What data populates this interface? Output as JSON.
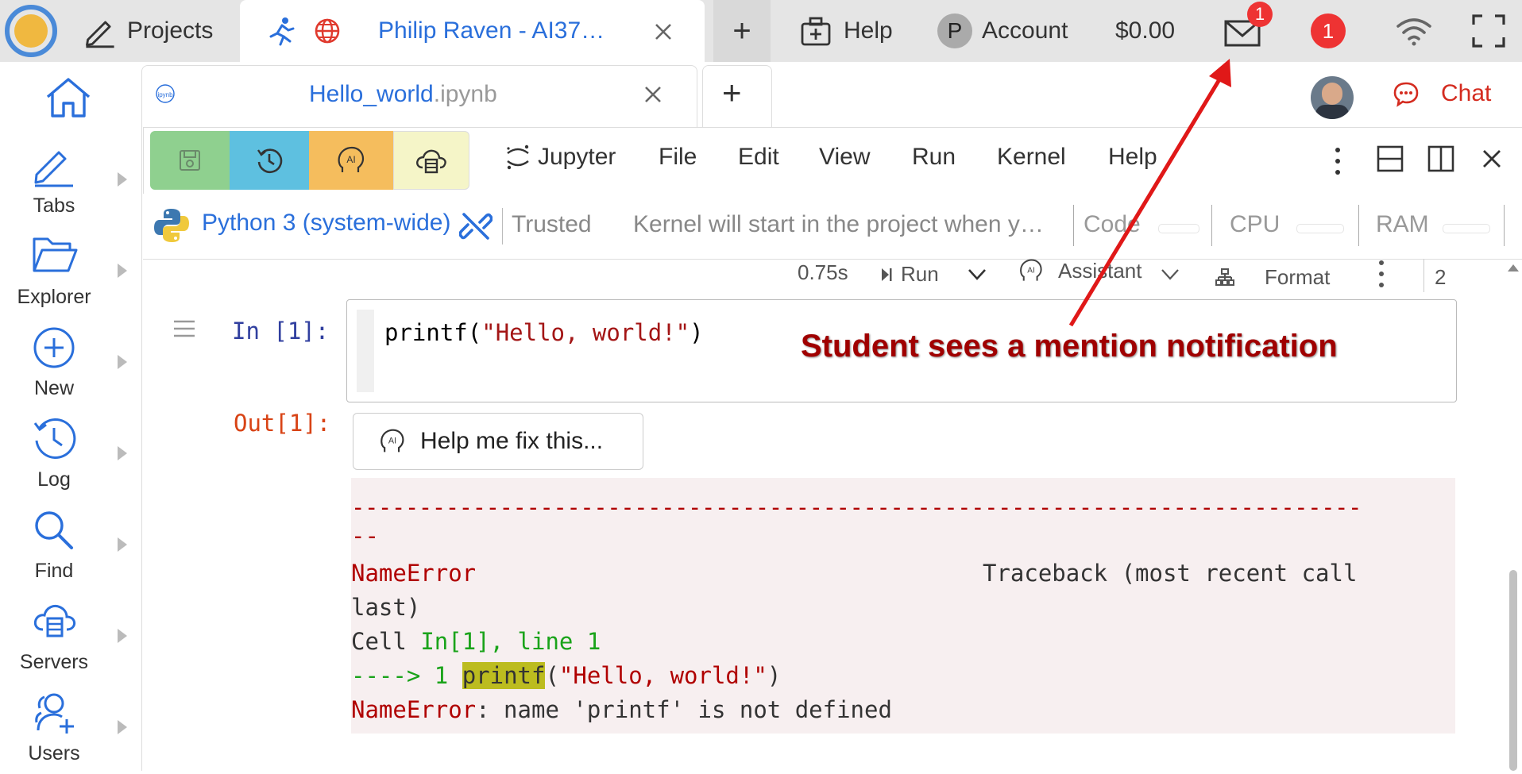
{
  "topbar": {
    "projects_label": "Projects",
    "active_tab_title": "Philip Raven - AI37…",
    "add_tab": "+",
    "help_label": "Help",
    "account_initial": "P",
    "account_label": "Account",
    "balance": "$0.00",
    "mail_badge": "1",
    "notifications_badge": "1"
  },
  "file_tab": {
    "name": "Hello_world",
    "ext": ".ipynb",
    "icon_text": "ipynb",
    "add": "+"
  },
  "chat_label": "Chat",
  "sidebar": {
    "items": [
      {
        "label": "Tabs"
      },
      {
        "label": "Explorer"
      },
      {
        "label": "New"
      },
      {
        "label": "Log"
      },
      {
        "label": "Find"
      },
      {
        "label": "Servers"
      },
      {
        "label": "Users"
      }
    ]
  },
  "toolbar": {
    "ai_label": "AI",
    "jupyter_label": "Jupyter",
    "menus": [
      "File",
      "Edit",
      "View",
      "Run",
      "Kernel",
      "Help"
    ]
  },
  "kernel": {
    "name": "Python 3 (system-wide)",
    "trusted": "Trusted",
    "status": "Kernel will start in the project when y…",
    "code_label": "Code",
    "cpu_label": "CPU",
    "ram_label": "RAM"
  },
  "cell_toolbar": {
    "time": "0.75s",
    "run": "Run",
    "assistant": "Assistant",
    "format": "Format",
    "cell_number": "2"
  },
  "cell": {
    "in_prompt": "In [1]:",
    "code_fn": "printf",
    "code_paren_open": "(",
    "code_string": "\"Hello, world!\"",
    "code_paren_close": ")",
    "out_prompt": "Out[1]:",
    "help_button": "Help me fix this..."
  },
  "traceback": {
    "dashes": "---------------------------------------------------------------------------",
    "error_type": "NameError",
    "traceback_header": "Traceback (most recent call",
    "last": "last)",
    "cell_prefix": "Cell ",
    "cell_location": "In[1], line 1",
    "arrow": "----> 1 ",
    "fn": "printf",
    "open": "(",
    "string": "\"Hello, world!\"",
    "close": ")",
    "error_name": "NameError",
    "error_message": ": name 'printf' is not defined"
  },
  "annotation": {
    "text": "Student sees a mention notification",
    "color": "#a00000"
  },
  "colors": {
    "accent_blue": "#2a6fdb",
    "chat_red": "#d42b1f",
    "badge_red": "#ee3333",
    "save_green": "#8fd08f",
    "history_blue": "#5ec0e0",
    "ai_orange": "#f5bd5d",
    "cloud_yellow": "#f5f5c8"
  }
}
